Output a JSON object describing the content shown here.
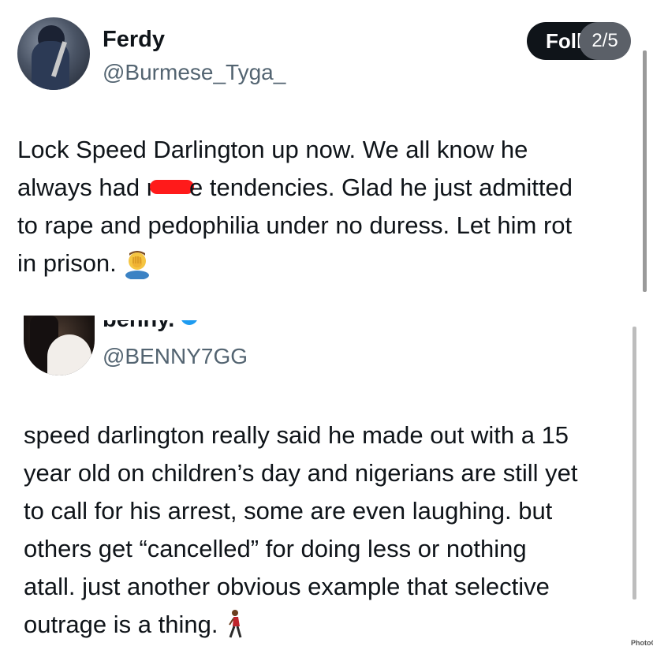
{
  "tweets": [
    {
      "display_name": "Ferdy",
      "handle": "@Burmese_Tyga_",
      "follow_label": "Foll",
      "image_counter": "2/5",
      "text_line1": "Lock Speed Darlington up now. We all know he",
      "text_line2_pre": "always had r",
      "text_line2_post": "e tendencies. Glad he just admitted",
      "text_line3": "to rape and pedophilia under no duress. Let him rot",
      "text_line4": "in prison.",
      "emoji": "man-facepalming-icon",
      "redaction_color": "#ff1a1a"
    },
    {
      "display_name": "benny.",
      "handle": "@BENNY7GG",
      "verified": true,
      "verified_color": "#1d9bf0",
      "text_line1": "speed darlington really said he made out with a 15",
      "text_line2": "year old on children’s day and nigerians are still yet",
      "text_line3": "to call for his arrest, some are even laughing. but",
      "text_line4": "others get “cancelled” for doing less or nothing",
      "text_line5": "atall. just another obvious example that selective",
      "text_line6": "outrage is a thing.",
      "emoji": "person-walking-icon"
    }
  ],
  "watermark": "PhotoG"
}
